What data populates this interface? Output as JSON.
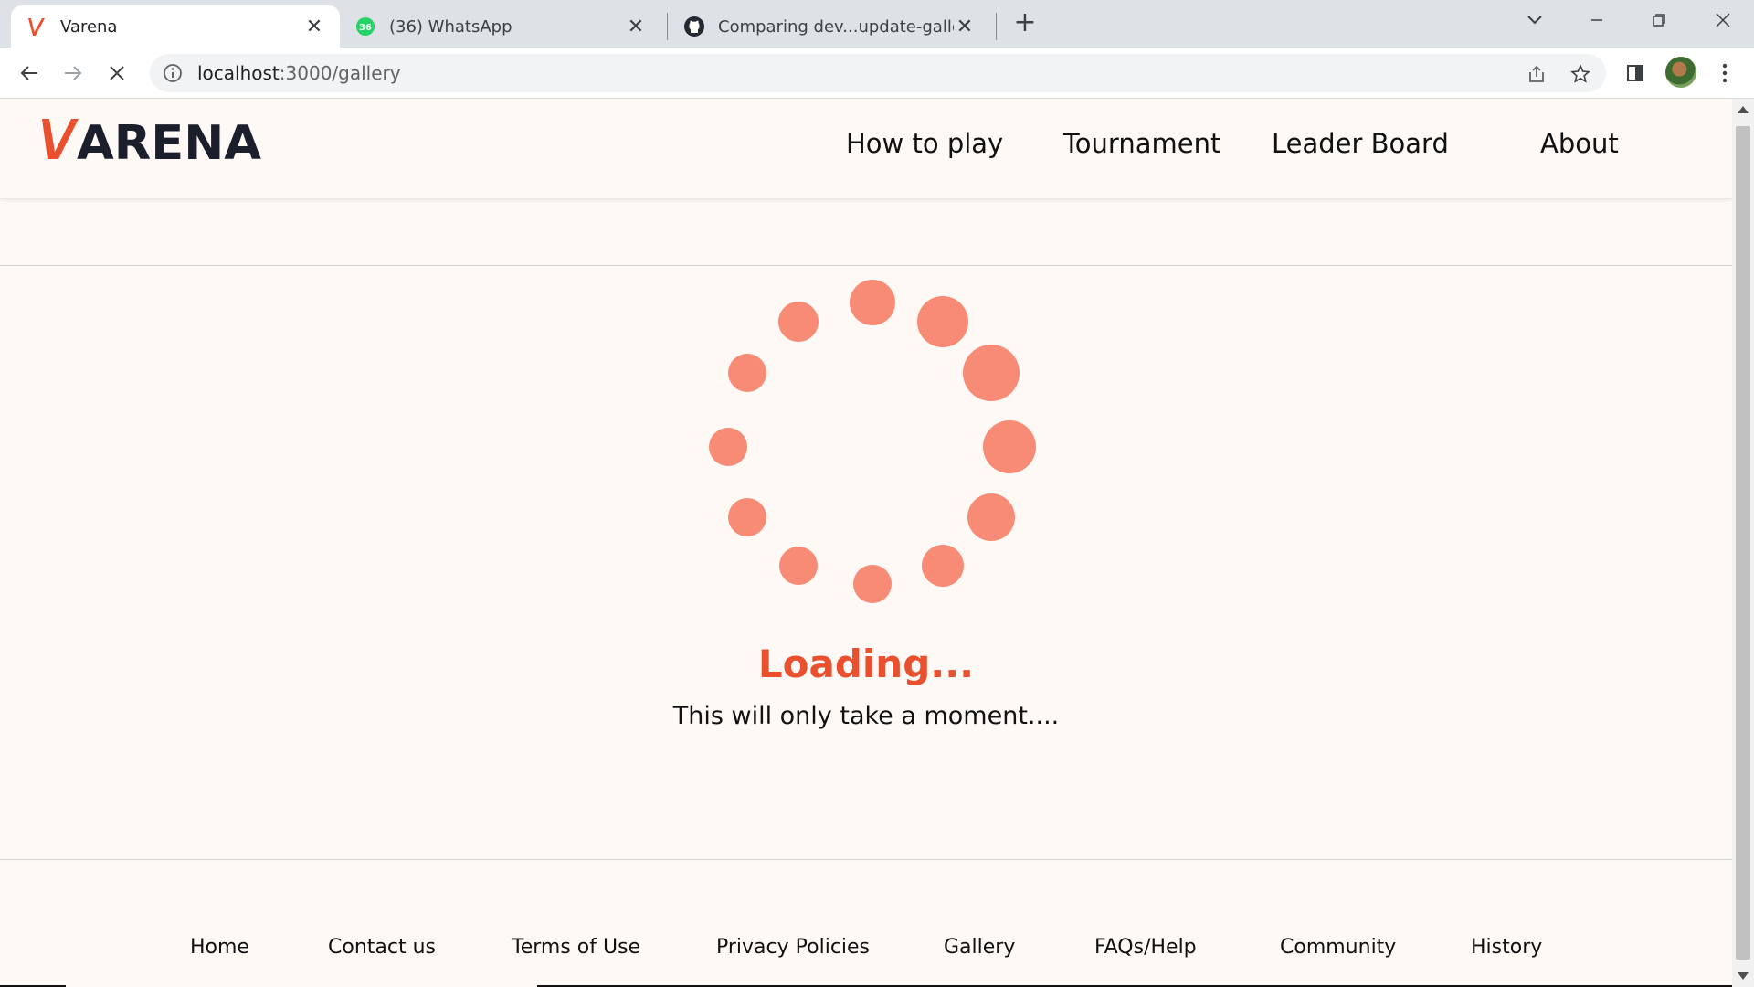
{
  "browser": {
    "tabs": [
      {
        "title": "Varena",
        "icon": "varena-logo-icon",
        "active": true
      },
      {
        "title": "(36) WhatsApp",
        "icon": "whatsapp-icon",
        "badge": "36",
        "active": false
      },
      {
        "title": "Comparing dev...update-gallery-",
        "icon": "github-icon",
        "active": false
      }
    ],
    "url_host": "localhost",
    "url_path": ":3000/gallery",
    "colors": {
      "whatsapp_badge": "#25d366"
    }
  },
  "site": {
    "logo_text": "ARENA",
    "nav": [
      "How to play",
      "Tournament",
      "Leader Board",
      "About"
    ],
    "loading": {
      "title": "Loading...",
      "subtitle": "This will only take a moment...."
    },
    "footer": [
      "Home",
      "Contact us",
      "Terms of Use",
      "Privacy Policies",
      "Gallery",
      "FAQs/Help",
      "Community",
      "History"
    ],
    "colors": {
      "accent": "#e8502e",
      "spinner_dot": "#f78b75",
      "page_bg": "#fff9f6",
      "logo_dark": "#1b1e2b"
    }
  }
}
